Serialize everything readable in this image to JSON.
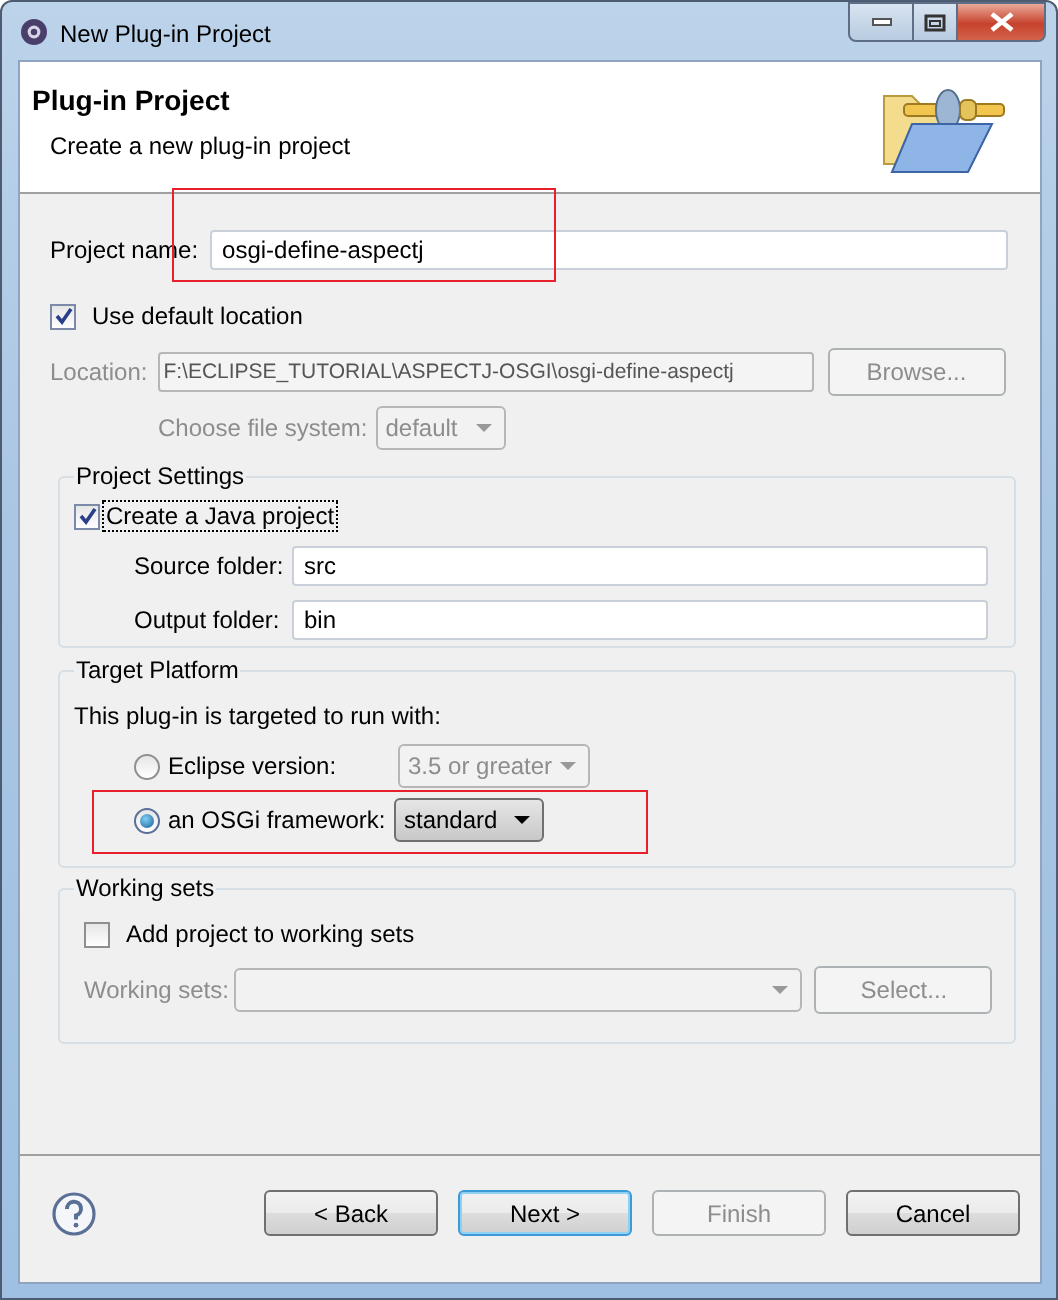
{
  "window": {
    "title": "New Plug-in Project"
  },
  "header": {
    "title": "Plug-in Project",
    "description": "Create a new plug-in project"
  },
  "project_name": {
    "label": "Project name:",
    "value": "osgi-define-aspectj",
    "highlighted": true
  },
  "default_location": {
    "label": "Use default location",
    "checked": true
  },
  "location": {
    "label": "Location:",
    "value": "F:\\ECLIPSE_TUTORIAL\\ASPECTJ-OSGI\\osgi-define-aspectj",
    "button": "Browse...",
    "disabled": true
  },
  "file_system": {
    "label": "Choose file system:",
    "value": "default",
    "disabled": true
  },
  "project_settings": {
    "title": "Project Settings",
    "java_project": {
      "label": "Create a Java project",
      "checked": true
    },
    "fields": [
      {
        "label": "Source folder:",
        "value": "src"
      },
      {
        "label": "Output folder:",
        "value": "bin"
      }
    ]
  },
  "target_platform": {
    "title": "Target Platform",
    "intro": "This plug-in is targeted to run with:",
    "options": [
      {
        "label": "Eclipse version:",
        "value": "3.5 or greater",
        "selected": false,
        "highlighted": false
      },
      {
        "label": "an OSGi framework:",
        "value": "standard",
        "selected": true,
        "highlighted": true
      }
    ]
  },
  "working_sets": {
    "title": "Working sets",
    "add": {
      "label": "Add project to working sets",
      "checked": false
    },
    "label": "Working sets:",
    "button": "Select...",
    "disabled": true
  },
  "buttons": [
    {
      "label": "< Back",
      "disabled": false,
      "default": false
    },
    {
      "label": "Next >",
      "disabled": false,
      "default": true
    },
    {
      "label": "Finish",
      "disabled": true,
      "default": false
    },
    {
      "label": "Cancel",
      "disabled": false,
      "default": false
    }
  ]
}
